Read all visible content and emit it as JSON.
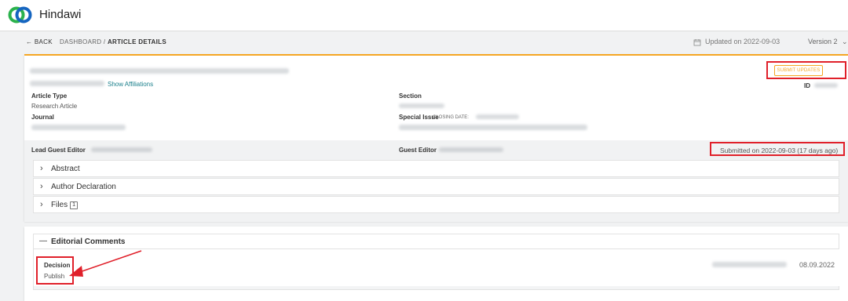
{
  "header": {
    "brand": "Hindawi"
  },
  "breadcrumb": {
    "back": "BACK",
    "dashboard": "DASHBOARD /",
    "current": "ARTICLE DETAILS",
    "updated": "Updated on 2022-09-03",
    "version": "Version 2"
  },
  "article": {
    "show_affiliations": "Show Affiliations",
    "submit_updates": "SUBMIT UPDATES",
    "id_label": "ID",
    "article_type_label": "Article Type",
    "article_type_value": "Research Article",
    "section_label": "Section",
    "journal_label": "Journal",
    "special_issue_label": "Special Issue",
    "closing_date_label": "CLOSING DATE:",
    "lead_guest_editor_label": "Lead Guest Editor",
    "guest_editor_label": "Guest Editor",
    "submitted": "Submitted on 2022-09-03 (17 days ago)"
  },
  "accordions": [
    {
      "label": "Abstract"
    },
    {
      "label": "Author Declaration"
    },
    {
      "label": "Files",
      "badge": "1"
    }
  ],
  "editorial": {
    "title": "Editorial Comments",
    "decision_label": "Decision",
    "decision_value": "Publish",
    "date": "08.09.2022"
  },
  "colors": {
    "accent": "#f5a623",
    "highlight": "#e0202a",
    "link": "#1a7f8b",
    "logo_green": "#2bb24c",
    "logo_blue": "#1565c0"
  }
}
